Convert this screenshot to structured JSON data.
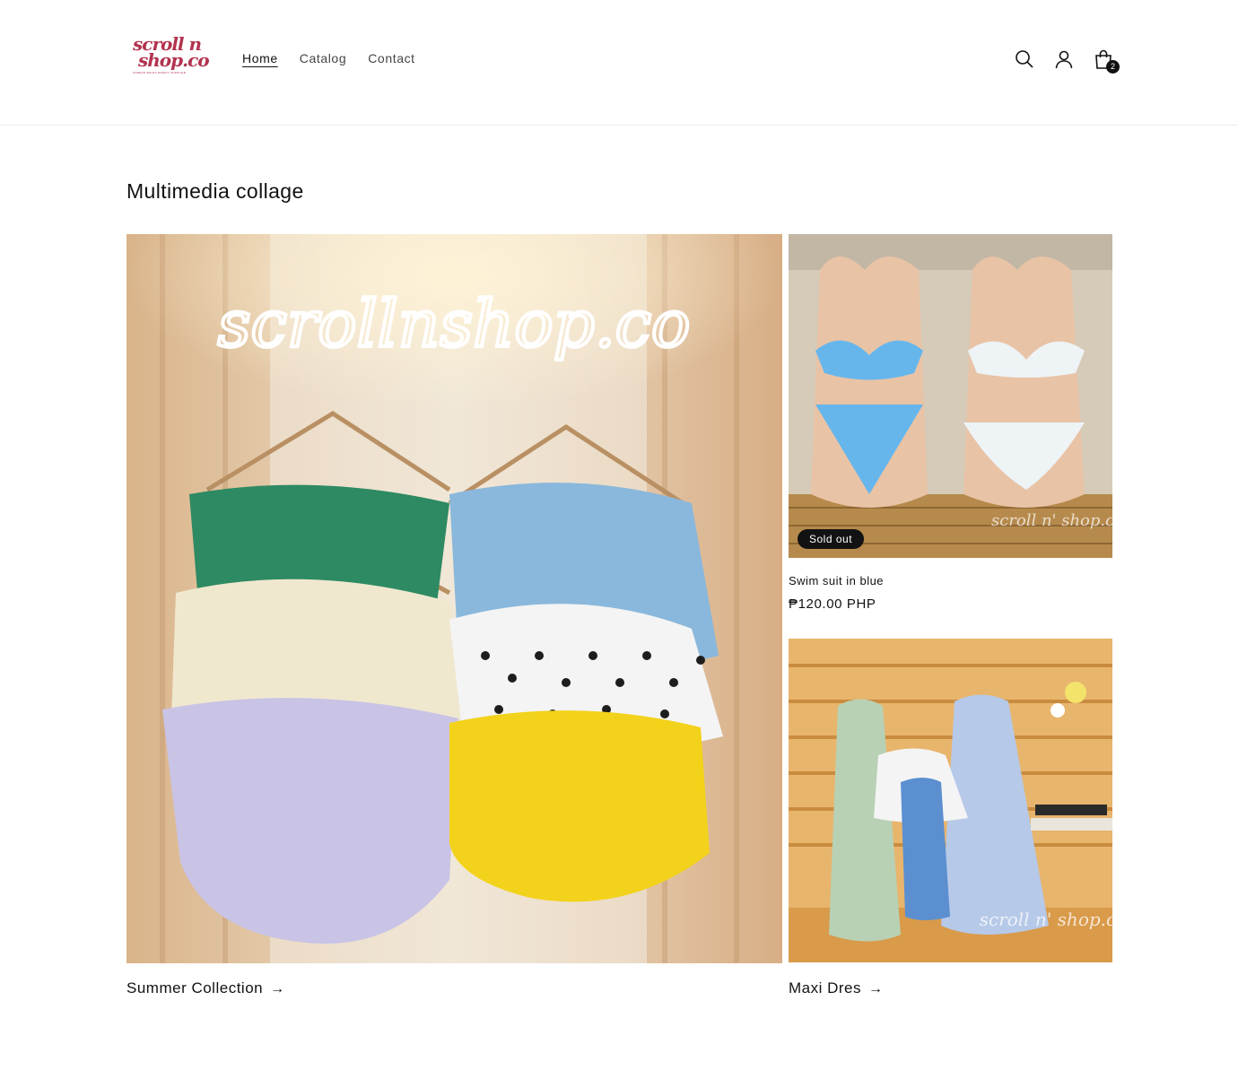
{
  "header": {
    "logo": {
      "line1": "scroll n",
      "line2": "shop.co",
      "tagline": "KOREAN BALES DIRECT SUPPLIER"
    },
    "nav": [
      {
        "label": "Home",
        "active": true
      },
      {
        "label": "Catalog",
        "active": false
      },
      {
        "label": "Contact",
        "active": false
      }
    ],
    "icons": [
      "search-icon",
      "account-icon",
      "cart-icon"
    ],
    "cart_count": "2"
  },
  "main": {
    "title": "Multimedia collage",
    "collage": {
      "large": {
        "image_text": "scrollnshop.co",
        "caption": "Summer Collection",
        "arrow": "→"
      },
      "product": {
        "badge": "Sold out",
        "title": "Swim suit in blue",
        "price": "₱120.00 PHP",
        "watermark": "scroll n' shop.co"
      },
      "small": {
        "caption": "Maxi Dres",
        "arrow": "→",
        "watermark": "scroll n' shop.co"
      }
    }
  },
  "colors": {
    "brand": "#b2334f",
    "text": "#121212",
    "badge_bg": "#121212"
  }
}
